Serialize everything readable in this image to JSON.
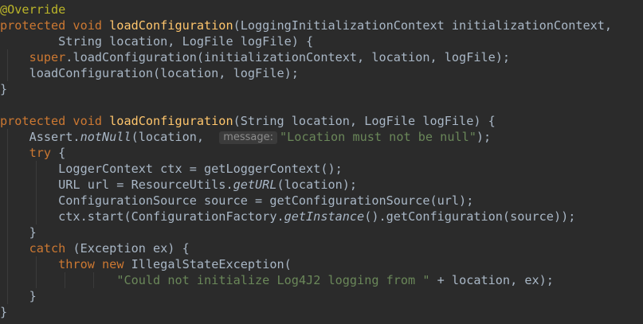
{
  "code": {
    "l1": {
      "annotation": "@Override"
    },
    "l2": {
      "kw": "protected void ",
      "method": "loadConfiguration",
      "rest": "(LoggingInitializationContext initializationContext,"
    },
    "l3": {
      "text": "        String location, LogFile logFile) {"
    },
    "l4": {
      "super": "    super",
      "rest": ".loadConfiguration(initializationContext, location, logFile);"
    },
    "l5": {
      "text": "    loadConfiguration(location, logFile);"
    },
    "l6": {
      "text": "}"
    },
    "l7": {
      "text": ""
    },
    "l8": {
      "kw": "protected void ",
      "method": "loadConfiguration",
      "rest": "(String location, LogFile logFile) {"
    },
    "l9": {
      "a": "    Assert.",
      "italic": "notNull",
      "b": "(location, ",
      "hint": "message:",
      "str": "\"Location must not be null\"",
      "c": ");"
    },
    "l10": {
      "kw": "    try",
      "rest": " {"
    },
    "l11": {
      "text": "        LoggerContext ctx = getLoggerContext();"
    },
    "l12": {
      "a": "        URL url = ResourceUtils.",
      "italic": "getURL",
      "b": "(location);"
    },
    "l13": {
      "text": "        ConfigurationSource source = getConfigurationSource(url);"
    },
    "l14": {
      "a": "        ctx.start(ConfigurationFactory.",
      "italic": "getInstance",
      "b": "().getConfiguration(source));"
    },
    "l15": {
      "text": "    }"
    },
    "l16": {
      "kw": "    catch",
      "rest": " (Exception ex) {"
    },
    "l17": {
      "kw1": "        throw",
      "sp": " ",
      "kw2": "new",
      "rest": " IllegalStateException("
    },
    "l18": {
      "indent": "                ",
      "str": "\"Could not initialize Log4J2 logging from \"",
      "rest": " + location, ex);"
    },
    "l19": {
      "text": "    }"
    },
    "l20": {
      "text": "}"
    }
  },
  "colors": {
    "background": "#2b2b2b",
    "text": "#a9b7c6",
    "keyword": "#cc7832",
    "method_declaration": "#ffc66d",
    "string": "#6a8759",
    "annotation": "#bbb529",
    "inlay_hint": "#8c8c8c"
  }
}
